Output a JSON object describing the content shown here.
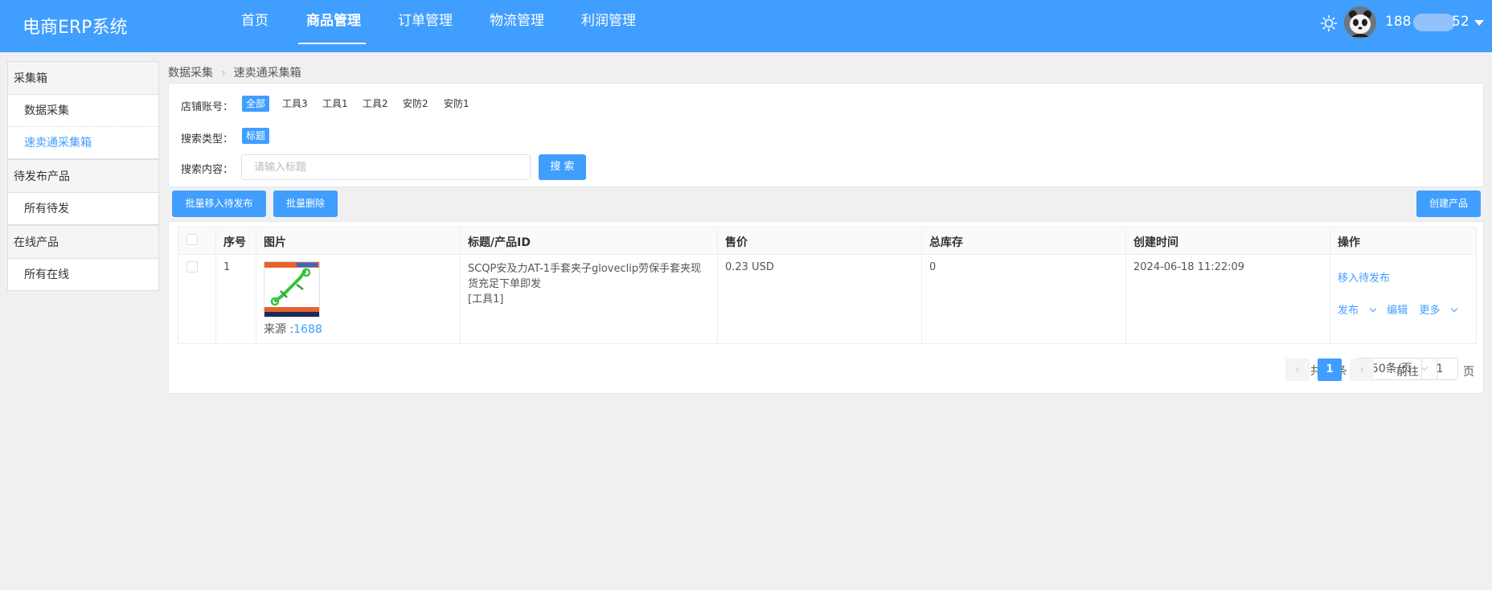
{
  "header": {
    "logo": "电商ERP系统",
    "nav": [
      "首页",
      "商品管理",
      "订单管理",
      "物流管理",
      "利润管理"
    ],
    "active_nav": "商品管理",
    "user": {
      "name_start": "188",
      "name_end": "52"
    },
    "icons": {
      "theme": "sun-icon",
      "menu": "caret-down-icon"
    }
  },
  "sidebar": {
    "groups": [
      {
        "title": "采集箱",
        "items": [
          "数据采集",
          "速卖通采集箱"
        ]
      },
      {
        "title": "待发布产品",
        "items": [
          "所有待发"
        ]
      },
      {
        "title": "在线产品",
        "items": [
          "所有在线"
        ]
      }
    ],
    "active_item": "速卖通采集箱"
  },
  "breadcrumb": [
    "数据采集",
    "速卖通采集箱"
  ],
  "filter": {
    "shop_label": "店铺账号：",
    "shop_tags": [
      "全部",
      "工具3",
      "工具1",
      "工具2",
      "安防2",
      "安防1"
    ],
    "shop_active": "全部",
    "type_label": "搜索类型：",
    "type_tags": [
      "标题"
    ],
    "content_label": "搜索内容：",
    "search_placeholder": "请输入标题",
    "search_value": "",
    "search_button": "搜 索"
  },
  "actions": {
    "move_batch": "批量移入待发布",
    "delete_batch": "批量删除",
    "create": "创建产品"
  },
  "table": {
    "headers": [
      "序号",
      "图片",
      "标题/产品ID",
      "售价",
      "总库存",
      "创建时间",
      "操作"
    ],
    "rows": [
      {
        "index": "1",
        "source_label": "来源 :",
        "source_value": "1688",
        "title": "SCQP安及力AT-1手套夹子gloveclip劳保手套夹现货充足下单即发",
        "shop": "[工具1]",
        "price": "0.23 USD",
        "stock": "0",
        "created": "2024-06-18 11:22:09",
        "op_move": "移入待发布",
        "op_publish": "发布",
        "op_edit": "编辑",
        "op_more": "更多"
      }
    ]
  },
  "pagination": {
    "total": "共 1 条",
    "page_size": "50条/页",
    "current": "1",
    "goto_label": "前往",
    "goto_value": "1",
    "page_unit": "页",
    "prev_icon": "chevron-left-icon",
    "next_icon": "chevron-right-icon"
  },
  "colors": {
    "primary": "#409eff",
    "background": "#f0f0f0"
  }
}
